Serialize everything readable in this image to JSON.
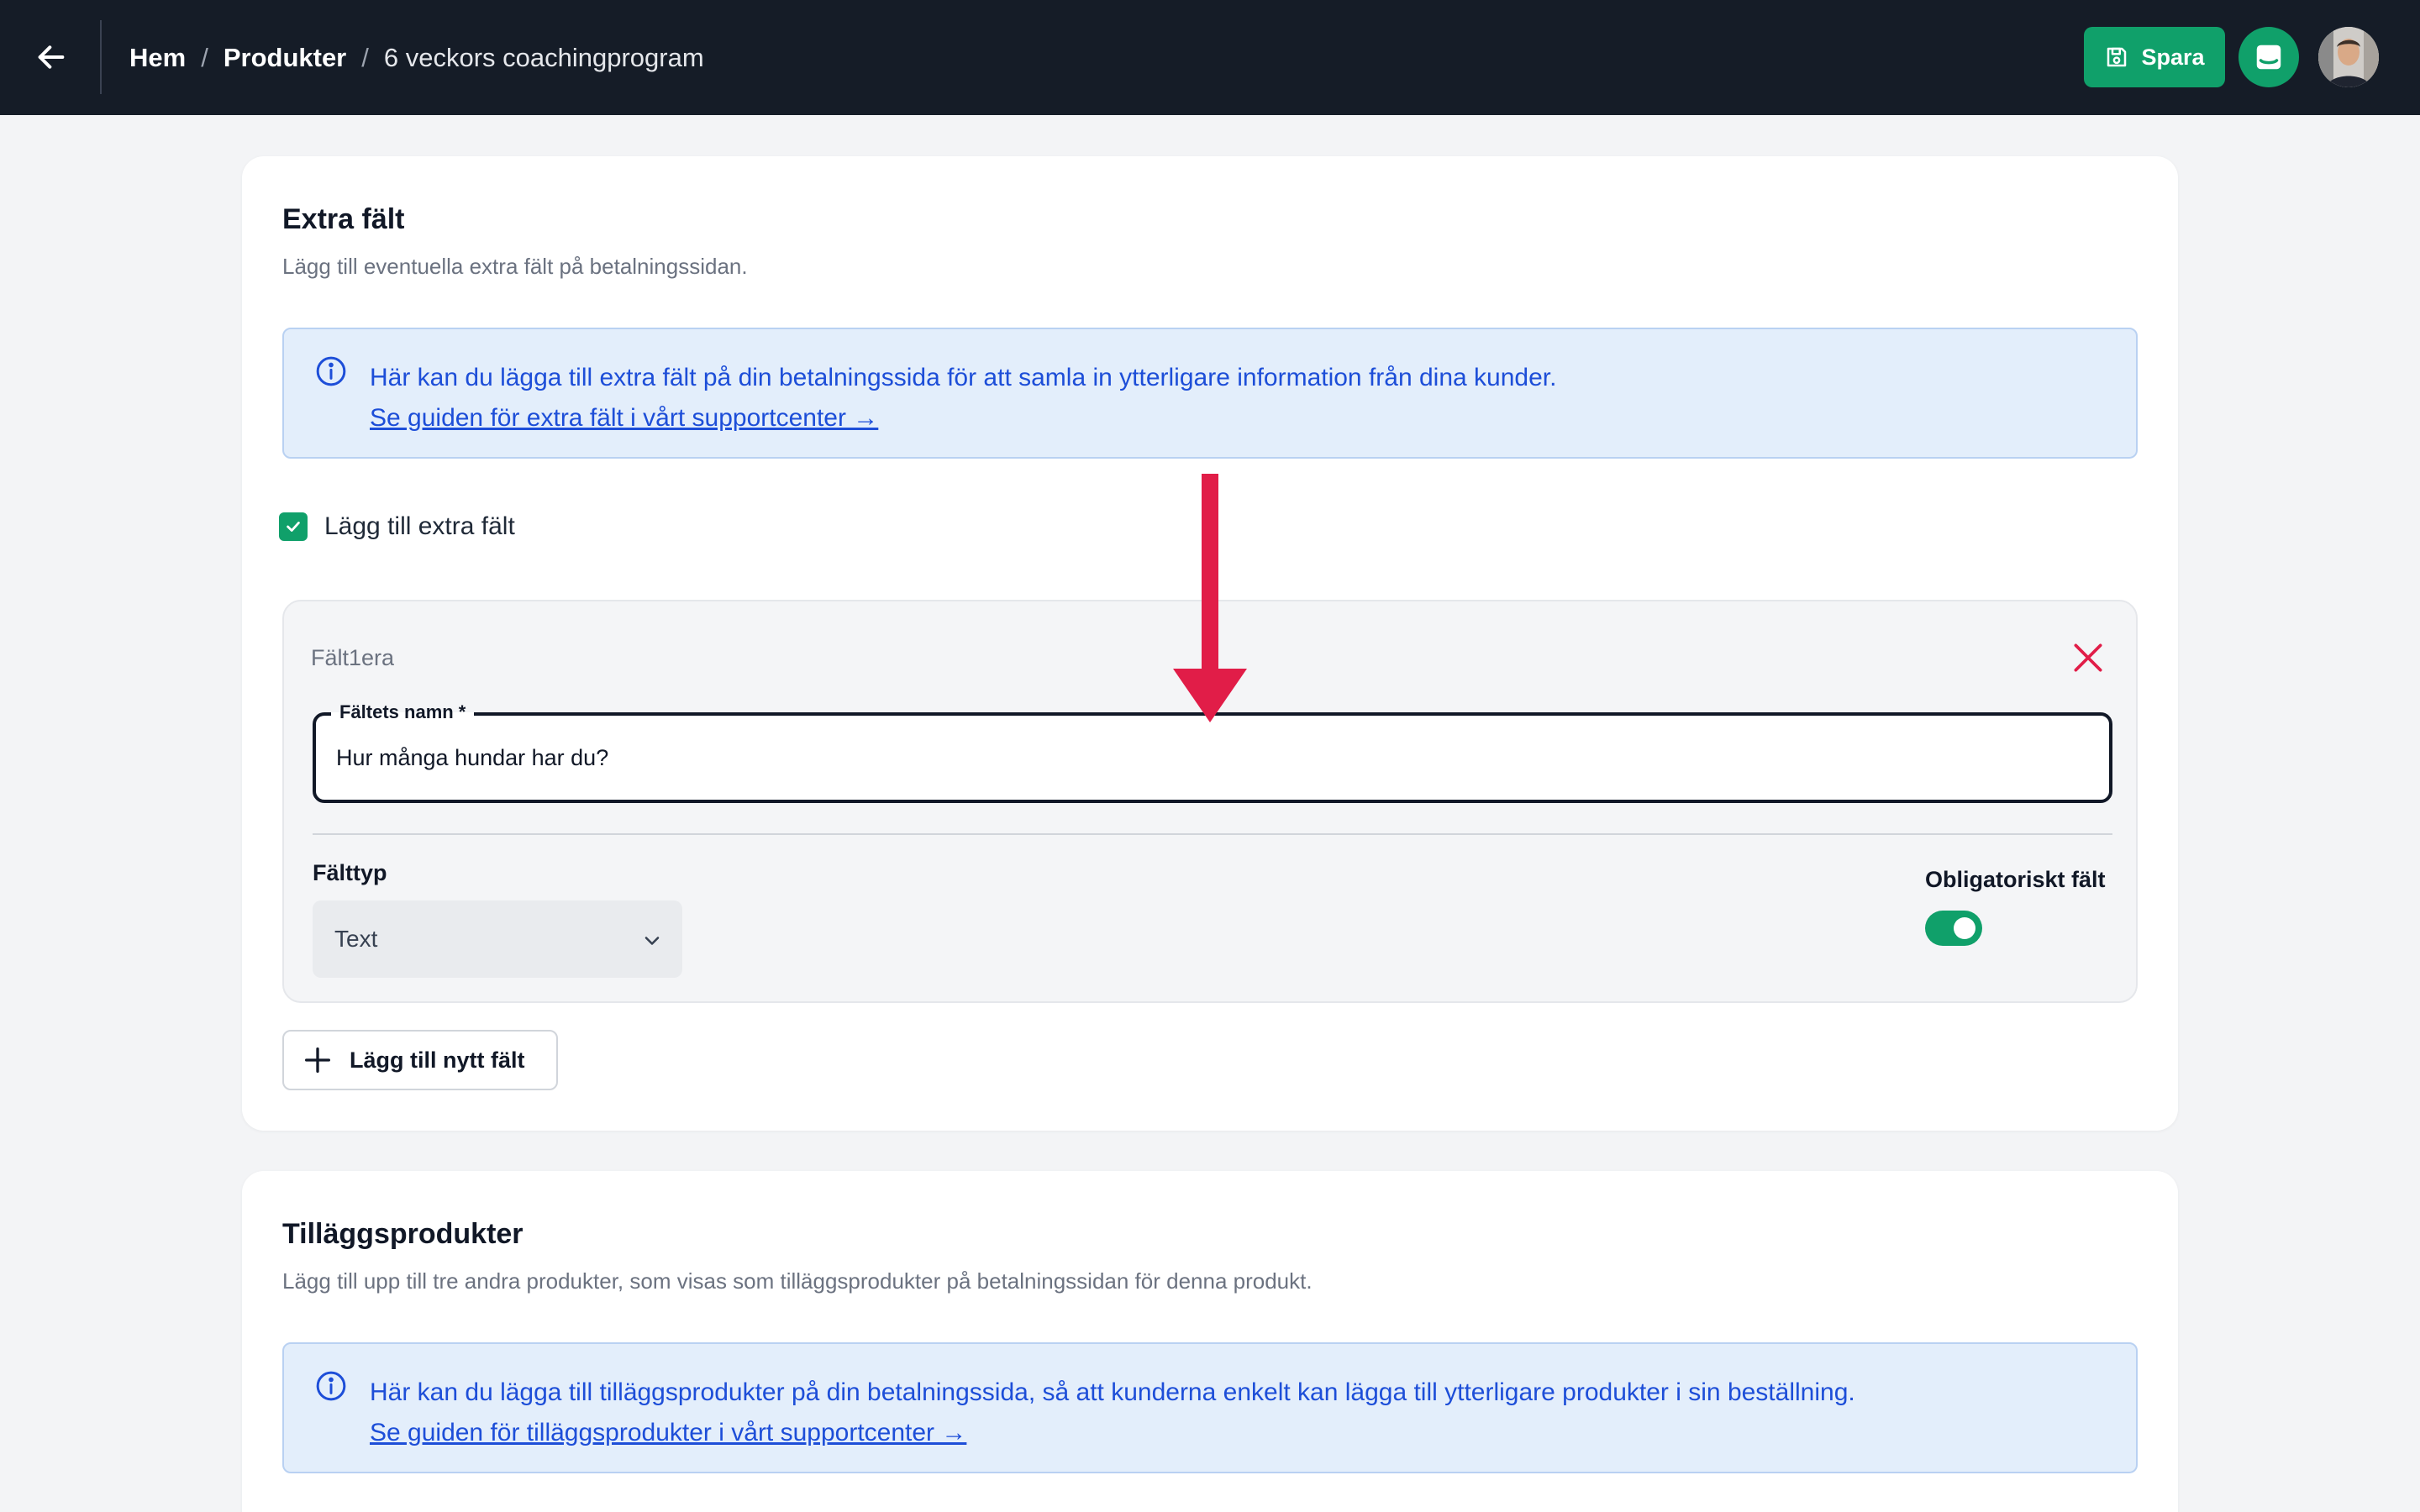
{
  "topbar": {
    "back_icon": "arrow-left-icon",
    "breadcrumb": {
      "home": "Hem",
      "products": "Produkter",
      "current": "6 veckors coachingprogram",
      "separator": "/"
    },
    "save_label": "Spara",
    "save_icon": "floppy-disk-icon",
    "inbox_icon": "inbox-icon",
    "accent_color": "#10a06a",
    "background_color": "#151c27"
  },
  "extra_fields": {
    "title": "Extra fält",
    "subtitle": "Lägg till eventuella extra fält på betalningssidan.",
    "info": {
      "text": "Här kan du lägga till extra fält på din betalningssida för att samla in ytterligare information från dina kunder.",
      "link": "Se guiden för extra fält i vårt supportcenter →"
    },
    "enable_checkbox": {
      "label": "Lägg till extra fält",
      "checked": true
    },
    "field": {
      "title": "Fält1era",
      "name_label": "Fältets namn *",
      "name_value": "Hur många hundar har du?",
      "type_label": "Fälttyp",
      "type_value": "Text",
      "required_label": "Obligatoriskt fält",
      "required_on": true
    },
    "add_field_label": "Lägg till nytt fält"
  },
  "addon_products": {
    "title": "Tilläggsprodukter",
    "subtitle": "Lägg till upp till tre andra produkter, som visas som tilläggsprodukter på betalningssidan för denna produkt.",
    "info": {
      "text": "Här kan du lägga till tilläggsprodukter på din betalningssida, så att kunderna enkelt kan lägga till ytterligare produkter i sin beställning.",
      "link": "Se guiden för tilläggsprodukter i vårt supportcenter →"
    }
  },
  "annotation": {
    "color": "#e11d48",
    "icon": "arrow-down-icon"
  }
}
